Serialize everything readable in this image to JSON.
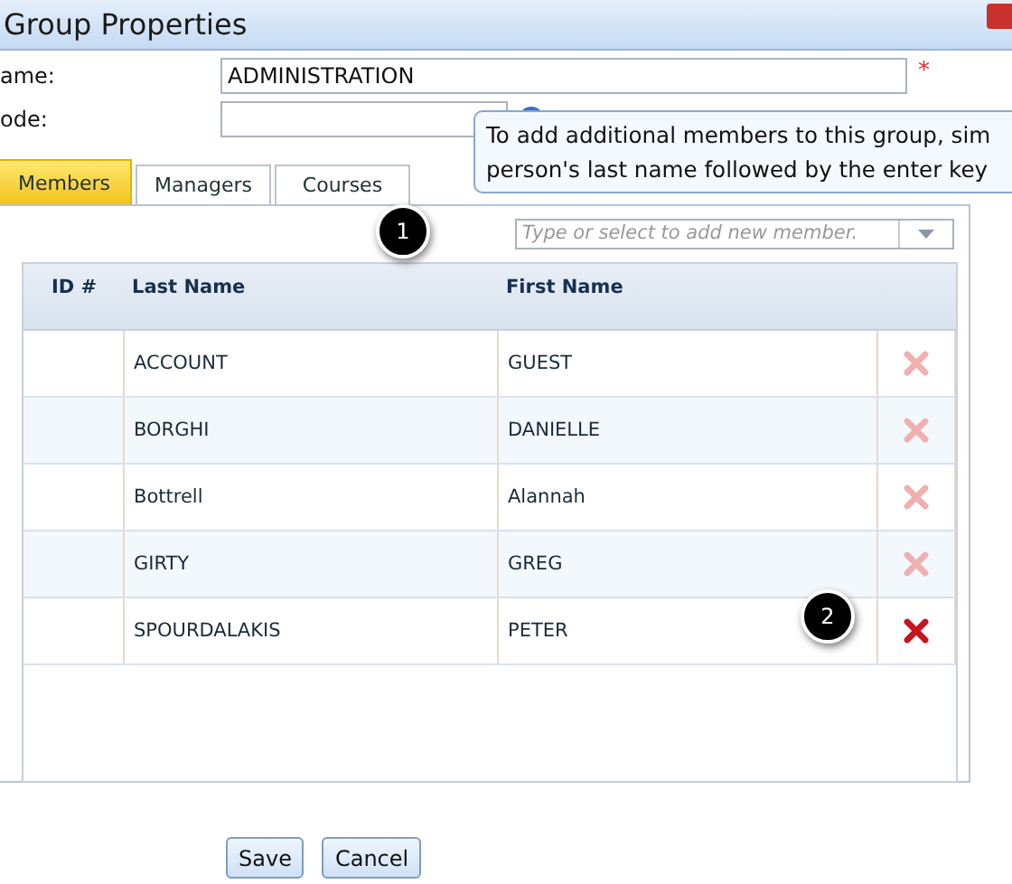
{
  "window": {
    "title": "Group Properties"
  },
  "form": {
    "name_label": "ame:",
    "name_value": "ADMINISTRATION",
    "required_mark": "*",
    "code_label": "ode:"
  },
  "tooltip": {
    "lines": [
      "To add additional members to this group, sim",
      "person's last name followed by the enter key"
    ]
  },
  "tabs": [
    {
      "label": "Members",
      "selected": true
    },
    {
      "label": "Managers",
      "selected": false
    },
    {
      "label": "Courses",
      "selected": false
    }
  ],
  "member_search": {
    "placeholder": "Type or select to add new member."
  },
  "callouts": [
    "1",
    "2"
  ],
  "table": {
    "columns": [
      "ID #",
      "Last Name",
      "First Name"
    ],
    "rows": [
      {
        "last_name": "ACCOUNT",
        "first_name": "GUEST",
        "highlighted": false
      },
      {
        "last_name": "BORGHI",
        "first_name": "DANIELLE",
        "highlighted": false
      },
      {
        "last_name": "Bottrell",
        "first_name": "Alannah",
        "highlighted": false
      },
      {
        "last_name": "GIRTY",
        "first_name": "GREG",
        "highlighted": false
      },
      {
        "last_name": "SPOURDALAKIS",
        "first_name": "PETER",
        "highlighted": true
      }
    ]
  },
  "buttons": [
    "Save",
    "Cancel"
  ]
}
